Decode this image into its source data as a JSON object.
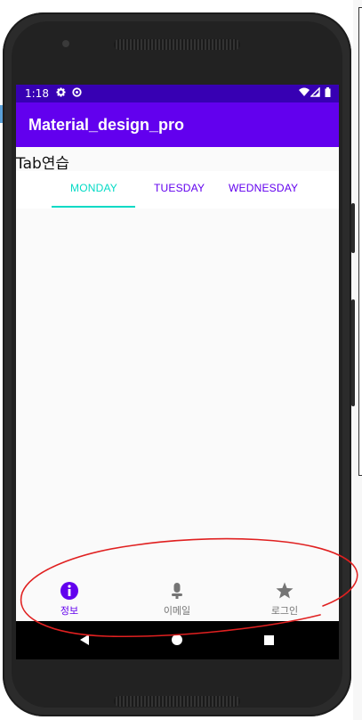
{
  "status_bar": {
    "time": "1:18",
    "left_icons": [
      "gear-icon",
      "no-sim-icon"
    ],
    "right_icons": [
      "wifi-icon",
      "signal-icon",
      "battery-icon"
    ]
  },
  "app_bar": {
    "title": "Material_design_pro"
  },
  "page": {
    "label": "Tab연습"
  },
  "tabs": [
    {
      "label": "MONDAY",
      "selected": true
    },
    {
      "label": "TUESDAY",
      "selected": false
    },
    {
      "label": "WEDNESDAY",
      "selected": false
    }
  ],
  "bottom_nav": [
    {
      "label": "정보",
      "icon": "info-icon",
      "selected": true
    },
    {
      "label": "이메일",
      "icon": "microphone-icon",
      "selected": false
    },
    {
      "label": "로그인",
      "icon": "star-icon",
      "selected": false
    }
  ],
  "colors": {
    "primary": "#6200ee",
    "primary_dark": "#3700b3",
    "accent": "#03dac5",
    "nav_selected": "#6200ee",
    "nav_unselected": "#757575",
    "annotation": "#e02020"
  }
}
